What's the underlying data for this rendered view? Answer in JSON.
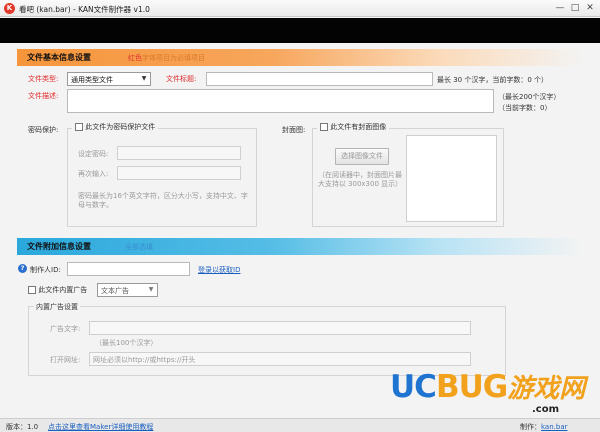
{
  "window": {
    "title": "看吧 (kan.bar) - KAN文件制作器 v1.0",
    "app_icon": "kan-app-icon",
    "controls": {
      "minimize": "—",
      "maximize": "□",
      "close": "✕"
    }
  },
  "basic_section": {
    "title": "文件基本信息设置",
    "note_red": "红色",
    "note_gray": "字体项目为必填项目",
    "file_type_label": "文件类型:",
    "file_type_value": "通用类型文件",
    "file_title_label": "文件标题:",
    "file_title_value": "",
    "file_title_hint": "最长 30 个汉字，当前字数：0 个）",
    "file_desc_label": "文件描述:",
    "file_desc_value": "",
    "file_desc_hint1": "（最长200个汉字）",
    "file_desc_hint2": "（当前字数：0）",
    "password_label": "密码保护:",
    "password_checkbox_label": "此文件为密码保护文件",
    "set_password_label": "设定密码:",
    "set_password_value": "",
    "reenter_label": "再次输入:",
    "reenter_value": "",
    "password_hint": "密码最长为16个英文字符，区分大小写，支持中文、字母与数字。",
    "cover_label": "封面图:",
    "cover_checkbox_label": "此文件有封面图像",
    "select_image_button": "选择图像文件",
    "cover_hint": "（在阅读器中，封面图片最大支持以 300x300 显示）"
  },
  "extra_section": {
    "title": "文件附加信息设置",
    "note_gray": "全部选填",
    "maker_id_label": "制作人ID:",
    "maker_id_value": "",
    "register_link": "登录以获取ID",
    "ad_checkbox_label": "此文件内置广告",
    "ad_type_value": "文本广告",
    "ad_group_title": "内置广告设置",
    "ad_text_label": "广告文字:",
    "ad_text_value": "",
    "ad_text_hint": "（最长100个汉字）",
    "open_url_label": "打开网址:",
    "open_url_value": "网址必须以http://或https://开头"
  },
  "footer": {
    "version_label": "版本：",
    "version_value": "1.0",
    "help_link": "点击这里查看Maker详细使用教程",
    "right_text": "制作：",
    "right_link": "kan.bar"
  },
  "watermark": {
    "uc": "UC",
    "bug": "BUG",
    "cn": "游戏网",
    "com": ".com"
  },
  "colors": {
    "orange_header": "#f6953a",
    "blue_header": "#2aa8dc",
    "required_red": "#e02a2a",
    "link_blue": "#1a5fc0",
    "banner_black": "#030303"
  }
}
